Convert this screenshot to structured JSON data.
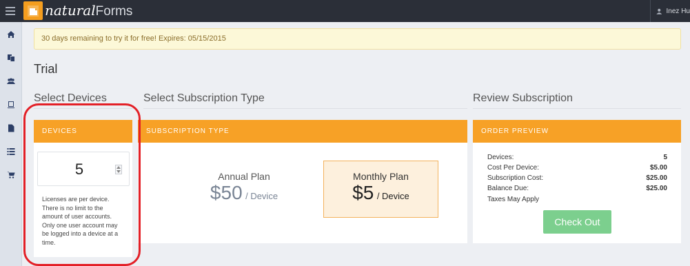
{
  "app": {
    "logo_small": "n",
    "logo_brand": "natural",
    "logo_brand_suffix": "Forms",
    "user_name": "Inez Hu"
  },
  "sidebar": {
    "items": [
      {
        "icon": "home-icon"
      },
      {
        "icon": "copy-forms-icon"
      },
      {
        "icon": "users-icon"
      },
      {
        "icon": "device-icon"
      },
      {
        "icon": "document-icon"
      },
      {
        "icon": "list-icon"
      },
      {
        "icon": "cart-icon"
      }
    ]
  },
  "banner": {
    "text": "30 days remaining to try it for free! Expires: 05/15/2015"
  },
  "page": {
    "title": "Trial"
  },
  "sections": {
    "devices": "Select Devices",
    "subscription": "Select Subscription Type",
    "review": "Review Subscription"
  },
  "devices_panel": {
    "header": "DEVICES",
    "count": "5",
    "note": "Licenses are per device. There is no limit to the amount of user accounts. Only one user account may be logged into a device at a time."
  },
  "subscription_panel": {
    "header": "SUBSCRIPTION TYPE",
    "annual": {
      "name": "Annual Plan",
      "price": "$50",
      "unit": "/ Device"
    },
    "monthly": {
      "name": "Monthly Plan",
      "price": "$5",
      "unit": "/ Device",
      "selected": true
    }
  },
  "order_panel": {
    "header": "ORDER PREVIEW",
    "rows": [
      {
        "label": "Devices:",
        "value": "5"
      },
      {
        "label": "Cost Per Device:",
        "value": "$5.00"
      },
      {
        "label": "Subscription Cost:",
        "value": "$25.00"
      },
      {
        "label": "Balance Due:",
        "value": "$25.00"
      },
      {
        "label": "Taxes May Apply",
        "value": ""
      }
    ],
    "checkout_label": "Check Out"
  },
  "colors": {
    "accent": "#f7a126",
    "checkout": "#7ccf8e",
    "highlight_circle": "#e32027",
    "topbar": "#2b2f38"
  }
}
